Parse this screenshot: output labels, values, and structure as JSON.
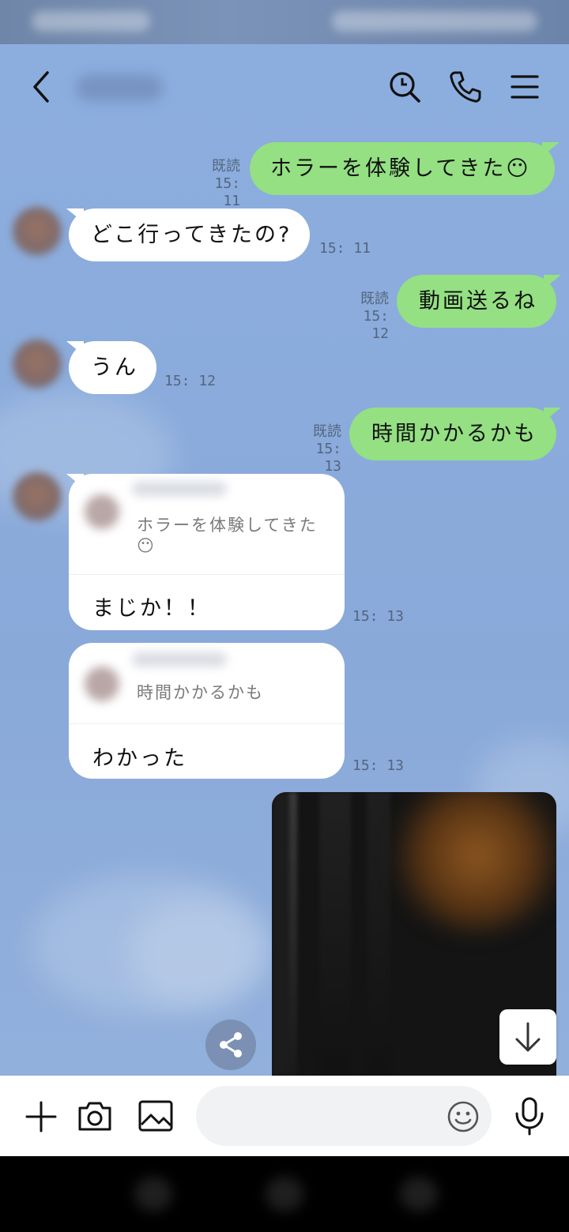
{
  "header": {
    "back_icon": "chevron-left-icon",
    "search_icon": "search-icon",
    "call_icon": "phone-icon",
    "menu_icon": "hamburger-menu-icon"
  },
  "messages": [
    {
      "side": "me",
      "text": "ホラーを体験してきた😶",
      "read": "既読",
      "time": "15: 11"
    },
    {
      "side": "them",
      "text": "どこ行ってきたの?",
      "time": "15: 11"
    },
    {
      "side": "me",
      "text": "動画送るね",
      "read": "既読",
      "time": "15: 12"
    },
    {
      "side": "them",
      "text": "うん",
      "time": "15: 12"
    },
    {
      "side": "me",
      "text": "時間かかるかも",
      "read": "既読",
      "time": "15: 13"
    },
    {
      "side": "them",
      "quote": "ホラーを体験してきた",
      "quote_emoji": "😶",
      "text": "まじか！！",
      "time": "15: 13"
    },
    {
      "side": "them",
      "quote": "時間かかるかも",
      "text": "わかった",
      "time": "15: 13"
    }
  ],
  "video_message": {
    "type": "video",
    "download_icon": "download-arrow-icon",
    "share_icon": "share-icon"
  },
  "input_bar": {
    "plus_icon": "plus-icon",
    "camera_icon": "camera-icon",
    "image_icon": "image-icon",
    "text_value": "",
    "emoji_icon": "emoji-icon",
    "mic_icon": "microphone-icon"
  },
  "colors": {
    "my_bubble": "#94e083",
    "their_bubble": "#ffffff",
    "chat_background": "#8aabdb"
  }
}
